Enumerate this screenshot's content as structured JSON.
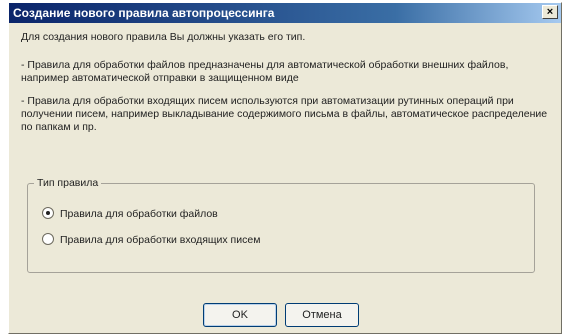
{
  "dialog": {
    "title": "Создание нового правила автопроцессинга",
    "close_glyph": "×",
    "intro": "Для создания нового правила Вы должны указать его тип.",
    "desc_files": "- Правила для обработки файлов предназначены для автоматической обработки внешних файлов, например автоматической отправки в защищенном виде",
    "desc_incoming": "- Правила для обработки входящих писем используются при автоматизации рутинных операций при получении писем, например выкладывание содержимого письма в файлы, автоматическое распределение по папкам и пр.",
    "group_label": "Тип правила",
    "options": [
      {
        "label": "Правила для обработки файлов",
        "selected": true
      },
      {
        "label": "Правила для обработки входящих писем",
        "selected": false
      }
    ],
    "ok_label": "OK",
    "cancel_label": "Отмена"
  }
}
